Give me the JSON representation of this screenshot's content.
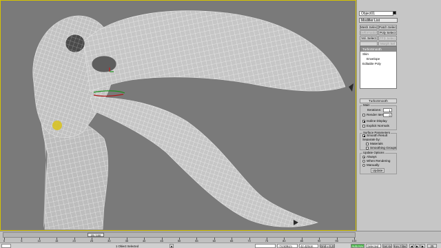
{
  "viewport": {
    "label": "",
    "background": "#7a7a7a",
    "border_color": "#d6c400"
  },
  "command_panel": {
    "object_name": "Object01",
    "modifier_list": "Modifier List",
    "buttons": [
      "Mesh Select",
      "Patch Select",
      "Deformation",
      "Poly Select",
      "Vol. Select",
      "FFD Select",
      "",
      "Morph Sel"
    ],
    "stack": [
      {
        "label": "TurboSmooth",
        "selected": true
      },
      {
        "label": "Skin",
        "selected": false
      },
      {
        "label": "Envelope",
        "selected": false
      },
      {
        "label": "Editable Poly",
        "selected": false
      }
    ],
    "rollout_title": "TurboSmooth",
    "main": {
      "group_label": "Main",
      "iterations_label": "Iterations:",
      "iterations_value": "1",
      "render_iters_label": "Render Iters:",
      "render_iters_value": "0",
      "isoline_label": "Isoline Display",
      "explicit_label": "Explicit Normals"
    },
    "surface": {
      "group_label": "Surface Parameters",
      "smooth_result_label": "Smooth Result",
      "separate_by_label": "Separate by:",
      "materials_label": "Materials",
      "smoothing_groups_label": "Smoothing Groups"
    },
    "update": {
      "group_label": "Update Options",
      "always_label": "Always",
      "when_rendering_label": "When Rendering",
      "manually_label": "Manually",
      "update_button": "Update"
    }
  },
  "timeline": {
    "frame_label": "25 / 100",
    "frame_position": 0.25,
    "ticks": [
      "0",
      "5",
      "10",
      "15",
      "20",
      "25",
      "30",
      "35",
      "40",
      "45",
      "50",
      "55",
      "60",
      "65",
      "70",
      "75",
      "80",
      "85",
      "90",
      "95",
      "100"
    ]
  },
  "status_bar": {
    "selection": "1 Object Selected",
    "x": "",
    "y": "-74.509cm",
    "z": "42.425cm",
    "grid": "Grid = 0.254m",
    "auto_key": "Auto Key",
    "set_key": "Set Key",
    "selected_dropdown": "Selected",
    "key_filters": "Key Filters..."
  },
  "colors": {
    "panel": "#c6c6c6",
    "mesh_fill": "#c4c4c4",
    "wire": "#ffffff",
    "key_green": "#3fae3f"
  }
}
